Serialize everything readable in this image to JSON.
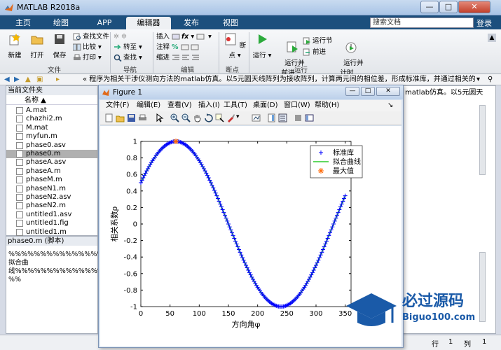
{
  "window": {
    "title": "MATLAB R2018a"
  },
  "tabs": [
    {
      "label": "主页"
    },
    {
      "label": "绘图"
    },
    {
      "label": "APP"
    },
    {
      "label": "编辑器"
    },
    {
      "label": "发布"
    },
    {
      "label": "视图"
    }
  ],
  "search": {
    "placeholder": "搜索文档"
  },
  "login_label": "登录",
  "ribbon": {
    "new": "新建",
    "open": "打开",
    "save": "保存",
    "find_file": "查找文件",
    "compare": "比较",
    "print": "打印",
    "goto": "转至",
    "find": "查找",
    "insert": "插入",
    "comment": "注释",
    "indent": "缩进",
    "breakpoints": "断点",
    "run": "运行",
    "run_advance": "运行并\n前进",
    "run_section": "运行节",
    "advance": "前进",
    "run_time": "运行并\n计时",
    "groups": {
      "file": "文件",
      "navigate": "导航",
      "edit": "编辑",
      "breakpoints": "断点",
      "run": "运行"
    }
  },
  "address": {
    "text": "«  程序为相关干涉仪测向方法的matlab仿真。以5元圆天线阵列为接收阵列，计算两元间的相位差，形成标准库，并通过相关的方式测得..."
  },
  "folder": {
    "header": "当前文件夹",
    "column": "名称 ▲",
    "files": [
      {
        "name": "A.mat"
      },
      {
        "name": "chazhi2.m"
      },
      {
        "name": "M.mat"
      },
      {
        "name": "myfun.m"
      },
      {
        "name": "phase0.asv"
      },
      {
        "name": "phase0.m",
        "selected": true
      },
      {
        "name": "phaseA.asv"
      },
      {
        "name": "phaseA.m"
      },
      {
        "name": "phaseM.m"
      },
      {
        "name": "phaseN1.m"
      },
      {
        "name": "phaseN2.asv"
      },
      {
        "name": "phaseN2.m"
      },
      {
        "name": "untitled1.asv"
      },
      {
        "name": "untitled1.fig"
      },
      {
        "name": "untitled1.m"
      }
    ]
  },
  "details": {
    "header": "phase0.m  (脚本)",
    "code": "%%%%%%%%%%%%%%%拟合曲\n线%%%%%%%%%%%%%%%%%\n%%"
  },
  "right_text": "matlab仿真。以5元圆天",
  "status": {
    "row_label": "行",
    "row": "1",
    "col_label": "列",
    "col": "1"
  },
  "figure": {
    "title": "Figure 1",
    "menu": [
      "文件(F)",
      "编辑(E)",
      "查看(V)",
      "插入(I)",
      "工具(T)",
      "桌面(D)",
      "窗口(W)",
      "帮助(H)"
    ]
  },
  "watermark": {
    "brand": "必过源码",
    "site": "Biguo100.com"
  },
  "chart_data": {
    "type": "line",
    "xlabel": "方向角φ",
    "ylabel": "相关系数ρ",
    "xlim": [
      0,
      360
    ],
    "ylim": [
      -1,
      1
    ],
    "xticks": [
      0,
      50,
      100,
      150,
      200,
      250,
      300,
      350
    ],
    "yticks": [
      -1,
      -0.8,
      -0.6,
      -0.4,
      -0.2,
      0,
      0.2,
      0.4,
      0.6,
      0.8,
      1
    ],
    "legend_position": "top-right",
    "series": [
      {
        "name": "标准库",
        "marker": "+",
        "color": "#0000ff",
        "function": "sin(x+30deg)",
        "x_range": [
          0,
          350
        ],
        "x_step": 2
      },
      {
        "name": "拟合曲线",
        "color": "#00c000",
        "function": "sin(x+30deg)",
        "x_range": [
          0,
          350
        ]
      },
      {
        "name": "最大值",
        "marker": "*",
        "color": "#ff6600",
        "x": [
          60
        ],
        "y": [
          1
        ]
      }
    ],
    "colors": {
      "curve": "#0000ff",
      "fit": "#00c000",
      "max": "#ff6600"
    }
  }
}
